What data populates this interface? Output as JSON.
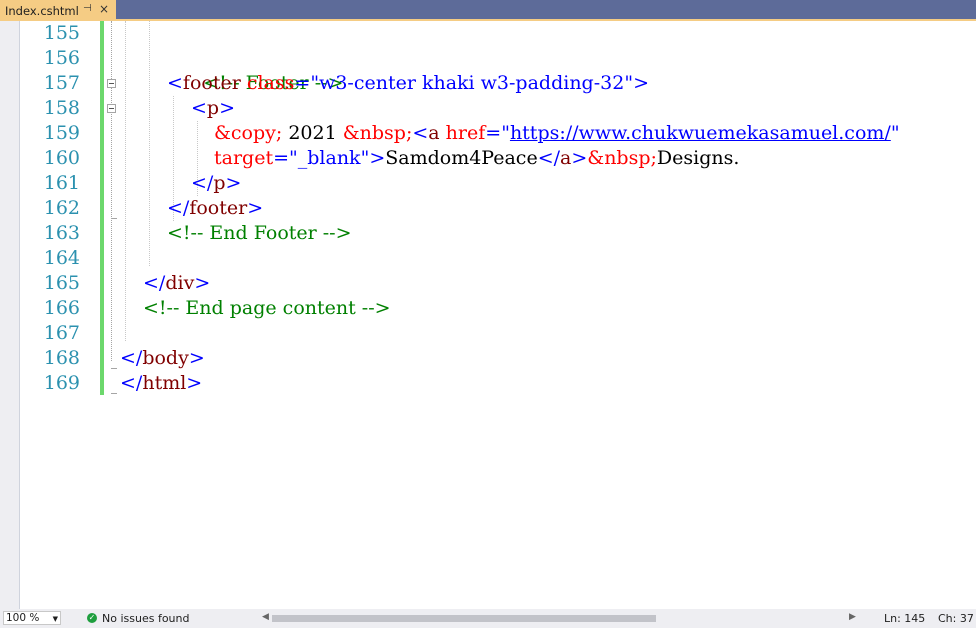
{
  "tab": {
    "title": "Index.cshtml",
    "pin_icon": "pin-icon",
    "close_icon": "close-icon"
  },
  "editor": {
    "line_numbers": [
      "155",
      "156",
      "157",
      "158",
      "159",
      "160",
      "161",
      "162",
      "163",
      "164",
      "165",
      "166",
      "167",
      "168",
      "169"
    ],
    "lines": {
      "l156": {
        "comment": "<!-- Footer -->"
      },
      "l157": {
        "lt": "<",
        "tag": "footer",
        "attr": " class",
        "eq": "=",
        "value": "\"w3-center khaki w3-padding-32\"",
        "gt": ">"
      },
      "l158": {
        "lt": "<",
        "tag": "p",
        "gt": ">"
      },
      "l159": {
        "entity1": "&copy;",
        "text1": " 2021 ",
        "entity2": "&nbsp;",
        "lt": "<",
        "tag": "a",
        "attr": " href",
        "eq": "=",
        "q1": "\"",
        "url": "https://www.chukwuemekasamuel.com/",
        "q2": "\""
      },
      "l160": {
        "attr": "target",
        "eq": "=",
        "value": "\"_blank\"",
        "gt": ">",
        "text": "Samdom4Peace",
        "close_open": "</",
        "close_tag": "a",
        "close_gt": ">",
        "entity": "&nbsp;",
        "text2": "Designs."
      },
      "l161": {
        "lt": "</",
        "tag": "p",
        "gt": ">"
      },
      "l162": {
        "lt": "</",
        "tag": "footer",
        "gt": ">"
      },
      "l163": {
        "comment": "<!-- End Footer -->"
      },
      "l165": {
        "lt": "</",
        "tag": "div",
        "gt": ">"
      },
      "l166": {
        "comment": "<!-- End page content -->"
      },
      "l168": {
        "lt": "</",
        "tag": "body",
        "gt": ">"
      },
      "l169": {
        "lt": "</",
        "tag": "html",
        "gt": ">"
      }
    }
  },
  "status": {
    "zoom": "100 %",
    "issues": "No issues found",
    "line": "Ln: 145",
    "col": "Ch: 37"
  },
  "colors": {
    "accent": "#f5cc84",
    "frame": "#5d6b99",
    "change_bar": "#6cd86c",
    "tag": "#800000",
    "bracket": "#0000ff",
    "attribute": "#ff0000",
    "comment": "#008000",
    "line_number": "#2b91af"
  }
}
